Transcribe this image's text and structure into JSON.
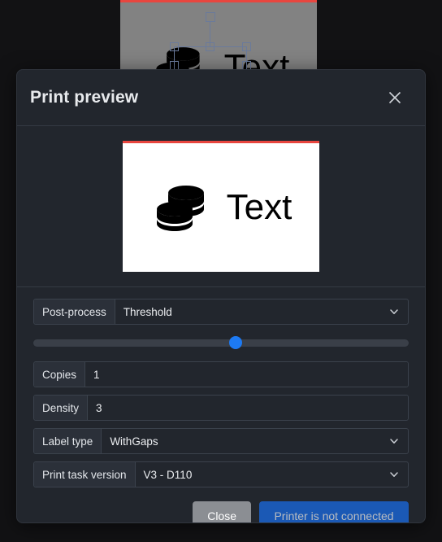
{
  "background": {
    "canvas_name": "label-editor-canvas",
    "accent_line_color": "#e8463f",
    "canvas_color": "#828282",
    "selection_color": "#6a7a9b",
    "artwork": {
      "icon": "coins-stack-icon",
      "text": "Text"
    }
  },
  "modal": {
    "title": "Print preview",
    "close_icon": "close-x-icon",
    "preview": {
      "name": "label-print-preview",
      "accent_line_color": "#e8463f",
      "paper_color": "#ffffff",
      "icon": "coins-stack-icon",
      "text": "Text"
    },
    "fields": [
      {
        "name": "post-process",
        "label": "Post-process",
        "value": "Threshold",
        "type": "select",
        "icon": "chevron-down-icon"
      },
      {
        "name": "copies",
        "label": "Copies",
        "value": "1",
        "type": "input",
        "icon": null
      },
      {
        "name": "density",
        "label": "Density",
        "value": "3",
        "type": "input",
        "icon": null
      },
      {
        "name": "label-type",
        "label": "Label type",
        "value": "WithGaps",
        "type": "select",
        "icon": "chevron-down-icon"
      },
      {
        "name": "print-task-version",
        "label": "Print task version",
        "value": "V3 - D110",
        "type": "select",
        "icon": "chevron-down-icon"
      }
    ],
    "threshold_slider": {
      "name": "threshold-slider",
      "percent": 54,
      "thumb_color": "#1d7af3",
      "track_color": "#3a3f48"
    },
    "buttons": {
      "close": {
        "label": "Close",
        "color": "#8b8e93"
      },
      "print": {
        "label": "Printer is not connected",
        "color": "#1b59b5",
        "enabled": false
      }
    }
  }
}
